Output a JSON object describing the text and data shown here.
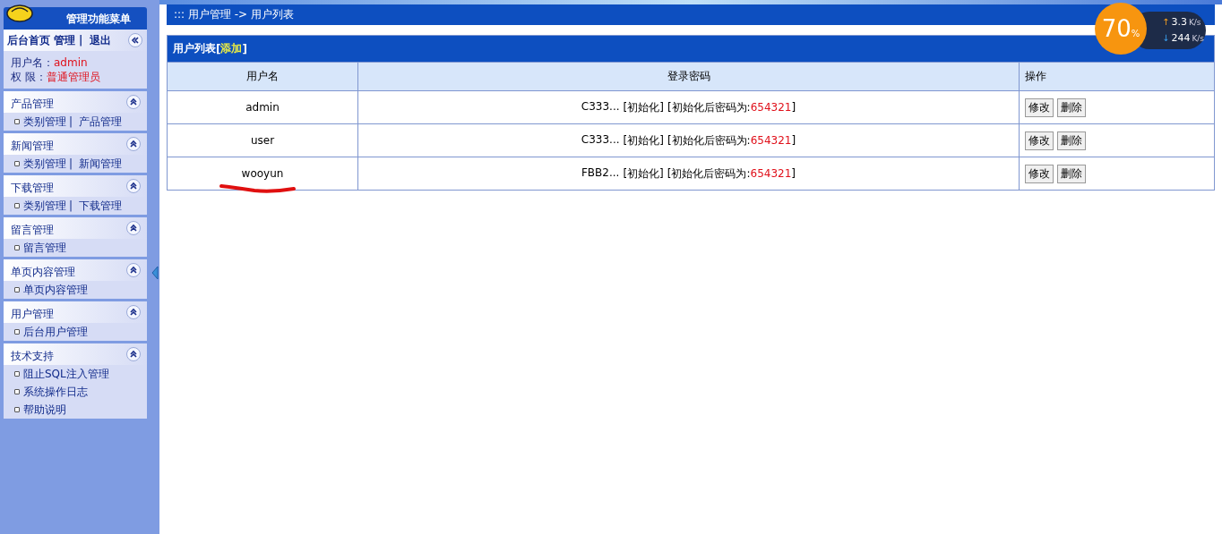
{
  "sidebar": {
    "title": "管理功能菜单",
    "top_links": [
      {
        "kind": "link",
        "text": "后台首页"
      },
      {
        "kind": "link",
        "text": "管理"
      },
      {
        "kind": "sep",
        "text": "|"
      },
      {
        "kind": "link",
        "text": "退出"
      }
    ],
    "user_info": [
      {
        "label": "用户名：",
        "value": "admin"
      },
      {
        "label": "权  限：",
        "value": "普通管理员"
      }
    ],
    "sections": [
      {
        "title": "产品管理",
        "expanded": true,
        "rows": [
          [
            {
              "kind": "link",
              "text": "类别管理"
            },
            {
              "kind": "sep",
              "text": "|"
            },
            {
              "kind": "link",
              "text": "产品管理"
            }
          ]
        ]
      },
      {
        "title": "新闻管理",
        "expanded": true,
        "rows": [
          [
            {
              "kind": "link",
              "text": "类别管理"
            },
            {
              "kind": "sep",
              "text": "|"
            },
            {
              "kind": "link",
              "text": "新闻管理"
            }
          ]
        ]
      },
      {
        "title": "下载管理",
        "expanded": true,
        "rows": [
          [
            {
              "kind": "link",
              "text": "类别管理"
            },
            {
              "kind": "sep",
              "text": "|"
            },
            {
              "kind": "link",
              "text": "下载管理"
            }
          ]
        ]
      },
      {
        "title": "留言管理",
        "expanded": true,
        "rows": [
          [
            {
              "kind": "link",
              "text": "留言管理"
            }
          ]
        ]
      },
      {
        "title": "单页内容管理",
        "expanded": true,
        "rows": [
          [
            {
              "kind": "link",
              "text": "单页内容管理"
            }
          ]
        ]
      },
      {
        "title": "用户管理",
        "expanded": true,
        "rows": [
          [
            {
              "kind": "link",
              "text": "后台用户管理"
            }
          ]
        ]
      },
      {
        "title": "技术支持",
        "expanded": true,
        "rows": [
          [
            {
              "kind": "link",
              "text": "阻止SQL注入管理"
            }
          ],
          [
            {
              "kind": "link",
              "text": "系统操作日志"
            }
          ],
          [
            {
              "kind": "link",
              "text": "帮助说明"
            }
          ]
        ]
      }
    ]
  },
  "breadcrumb": "::: 用户管理 -> 用户列表",
  "panel": {
    "title": "用户列表",
    "add_link": {
      "open": "[",
      "label": "添加",
      "close": "]"
    }
  },
  "table": {
    "columns": [
      "用户名",
      "登录密码",
      "操作"
    ],
    "rows": [
      {
        "username": "admin",
        "hash": "C333...",
        "reset": "[初始化]",
        "note": "[初始化后密码为:",
        "note_value": "654321",
        "note_end": "]",
        "actions": [
          "修改",
          "删除"
        ],
        "marked": false
      },
      {
        "username": "user",
        "hash": "C333...",
        "reset": "[初始化]",
        "note": "[初始化后密码为:",
        "note_value": "654321",
        "note_end": "]",
        "actions": [
          "修改",
          "删除"
        ],
        "marked": false
      },
      {
        "username": "wooyun",
        "hash": "FBB2...",
        "reset": "[初始化]",
        "note": "[初始化后密码为:",
        "note_value": "654321",
        "note_end": "]",
        "actions": [
          "修改",
          "删除"
        ],
        "marked": true
      }
    ]
  },
  "speed_widget": {
    "percent": "70",
    "percent_sign": "%",
    "upload": {
      "arrow": "↑",
      "value": "3.3",
      "unit": "K/s"
    },
    "download": {
      "arrow": "↓",
      "value": "244",
      "unit": "K/s"
    }
  }
}
